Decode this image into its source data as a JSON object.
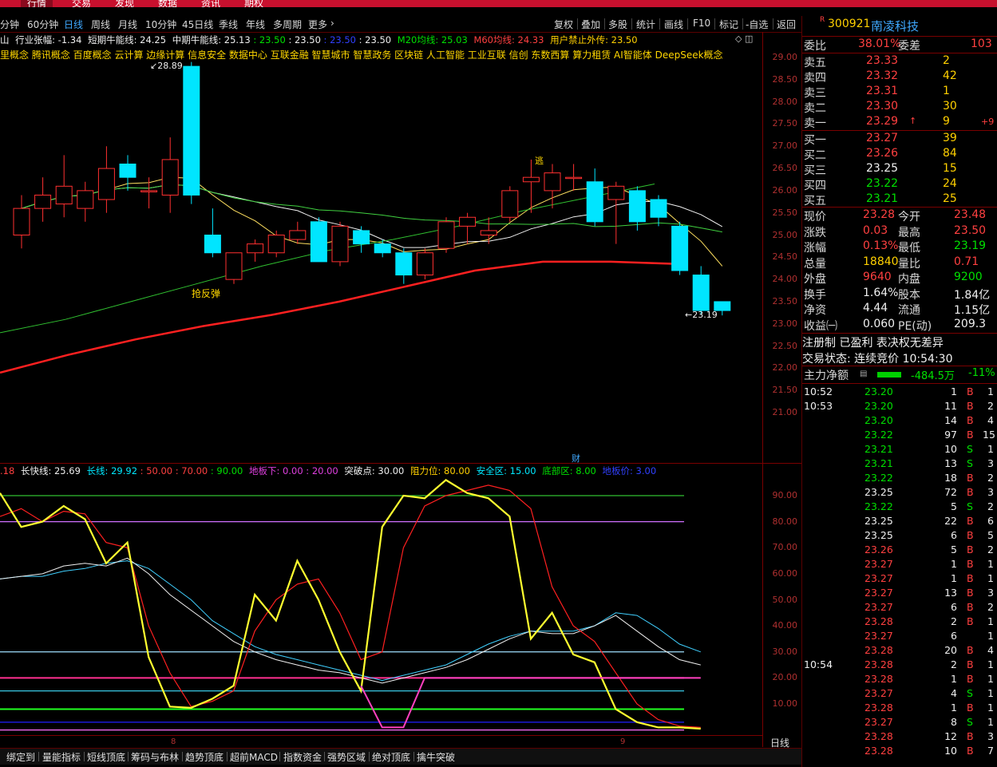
{
  "top_nav": {
    "items": [
      "行情",
      "交易",
      "发现",
      "数据",
      "资讯",
      "期权"
    ]
  },
  "period_bar": {
    "periods": [
      "分钟",
      "60分钟",
      "日线",
      "周线",
      "月线",
      "10分钟",
      "45日线",
      "季线",
      "年线",
      "多周期",
      "更多"
    ],
    "active": "日线",
    "tools": [
      "复权",
      "叠加",
      "多股",
      "统计",
      "画线",
      "F10",
      "标记",
      "-自选",
      "返回"
    ]
  },
  "main_header": {
    "seg1": "山",
    "seg2": "行业张幅: -1.34",
    "seg3": "短期牛能线: 24.25",
    "seg4": "中期牛能线: 25.13",
    "seg5": ": 23.50",
    "seg6": ": 23.50",
    "seg7": ": 23.50",
    "seg8": ": 23.50",
    "seg9": "M20均线: 25.03",
    "seg10": "M60均线: 24.33",
    "seg11": "用户禁止外传: 23.50"
  },
  "concepts": "里概念 腾讯概念 百度概念 云计算 边缘计算 信息安全 数据中心 互联金融 智慧城市 智慧政务 区块链 人工智能 工业互联 信创 东数西算 算力租赁 AI智能体 DeepSeek概念",
  "main_axis": [
    "29.00",
    "28.50",
    "28.00",
    "27.50",
    "27.00",
    "26.50",
    "26.00",
    "25.50",
    "25.00",
    "24.50",
    "24.00",
    "23.50",
    "23.00",
    "22.50",
    "22.00",
    "21.50",
    "21.00"
  ],
  "annotations": {
    "high": "28.89",
    "low": "23.19",
    "rebound": "抢反弹",
    "escape": "逃",
    "finance": "财"
  },
  "sub_header": {
    "seg1": ".18",
    "seg2": "长快线: 25.69",
    "seg3": "长线: 29.92",
    "seg4": ": 50.00",
    "seg5": ": 70.00",
    "seg6": ": 90.00",
    "seg7": "地板下: 0.00",
    "seg8": ": 20.00",
    "seg9": "突破点: 30.00",
    "seg10": "阻力位: 80.00",
    "seg11": "安全区: 15.00",
    "seg12": "底部区: 8.00",
    "seg13": "地板价: 3.00"
  },
  "sub_axis": [
    "90.00",
    "80.00",
    "70.00",
    "60.00",
    "50.00",
    "40.00",
    "30.00",
    "20.00",
    "10.00"
  ],
  "month_marks": [
    "8",
    "9"
  ],
  "bottom_right": {
    "period": "日线",
    "plus": "+",
    "minus": "-"
  },
  "bottom_tabs": [
    "绑定到",
    "量能指标",
    "短线顶底",
    "筹码与布林",
    "趋势顶底",
    "超前MACD",
    "指数资金",
    "强势区域",
    "绝对顶底",
    "擒牛突破"
  ],
  "stock": {
    "badge": "R",
    "code": "300921",
    "name": "南凌科技"
  },
  "committee": {
    "ratio_label": "委比",
    "ratio": "38.01%",
    "diff_label": "委差",
    "diff": "103"
  },
  "asks": [
    {
      "label": "卖五",
      "price": "23.33",
      "vol": "2",
      "extra": ""
    },
    {
      "label": "卖四",
      "price": "23.32",
      "vol": "42",
      "extra": ""
    },
    {
      "label": "卖三",
      "price": "23.31",
      "vol": "1",
      "extra": ""
    },
    {
      "label": "卖二",
      "price": "23.30",
      "vol": "30",
      "extra": ""
    },
    {
      "label": "卖一",
      "price": "23.29",
      "vol": "9",
      "extra": "+9"
    }
  ],
  "bids": [
    {
      "label": "买一",
      "price": "23.27",
      "vol": "39"
    },
    {
      "label": "买二",
      "price": "23.26",
      "vol": "84"
    },
    {
      "label": "买三",
      "price": "23.25",
      "vol": "15"
    },
    {
      "label": "买四",
      "price": "23.22",
      "vol": "24"
    },
    {
      "label": "买五",
      "price": "23.21",
      "vol": "25"
    }
  ],
  "quote": [
    {
      "l1": "现价",
      "v1": "23.28",
      "c1": "red",
      "l2": "今开",
      "v2": "23.48",
      "c2": "red"
    },
    {
      "l1": "涨跌",
      "v1": "0.03",
      "c1": "red",
      "l2": "最高",
      "v2": "23.50",
      "c2": "red"
    },
    {
      "l1": "涨幅",
      "v1": "0.13%",
      "c1": "red",
      "l2": "最低",
      "v2": "23.19",
      "c2": "green"
    },
    {
      "l1": "总量",
      "v1": "18840",
      "c1": "yellow",
      "l2": "量比",
      "v2": "0.71",
      "c2": "red"
    },
    {
      "l1": "外盘",
      "v1": "9640",
      "c1": "red",
      "l2": "内盘",
      "v2": "9200",
      "c2": "green"
    },
    {
      "l1": "换手",
      "v1": "1.64%",
      "c1": "white",
      "l2": "股本",
      "v2": "1.84亿",
      "c2": "white"
    },
    {
      "l1": "净资",
      "v1": "4.44",
      "c1": "white",
      "l2": "流通",
      "v2": "1.15亿",
      "c2": "white"
    },
    {
      "l1": "收益㈠",
      "v1": "0.060",
      "c1": "white",
      "l2": "PE(动)",
      "v2": "209.3",
      "c2": "white"
    }
  ],
  "registration": "注册制 已盈利 表决权无差异",
  "trade_status": "交易状态: 连续竞价 10:54:30",
  "main_force": {
    "label": "主力净额",
    "value": "-484.5万",
    "pct": "-11%"
  },
  "ticks": [
    {
      "time": "10:52",
      "price": "23.20",
      "pc": "green",
      "vol": "1",
      "side": "B",
      "n": "1"
    },
    {
      "time": "10:53",
      "price": "23.20",
      "pc": "green",
      "vol": "11",
      "side": "B",
      "n": "2"
    },
    {
      "time": "",
      "price": "23.20",
      "pc": "green",
      "vol": "14",
      "side": "B",
      "n": "4"
    },
    {
      "time": "",
      "price": "23.22",
      "pc": "green",
      "vol": "97",
      "side": "B",
      "n": "15"
    },
    {
      "time": "",
      "price": "23.21",
      "pc": "green",
      "vol": "10",
      "side": "S",
      "n": "1"
    },
    {
      "time": "",
      "price": "23.21",
      "pc": "green",
      "vol": "13",
      "side": "S",
      "n": "3"
    },
    {
      "time": "",
      "price": "23.22",
      "pc": "green",
      "vol": "18",
      "side": "B",
      "n": "2"
    },
    {
      "time": "",
      "price": "23.25",
      "pc": "white",
      "vol": "72",
      "side": "B",
      "n": "3"
    },
    {
      "time": "",
      "price": "23.22",
      "pc": "green",
      "vol": "5",
      "side": "S",
      "n": "2"
    },
    {
      "time": "",
      "price": "23.25",
      "pc": "white",
      "vol": "22",
      "side": "B",
      "n": "6"
    },
    {
      "time": "",
      "price": "23.25",
      "pc": "white",
      "vol": "6",
      "side": "B",
      "n": "5"
    },
    {
      "time": "",
      "price": "23.26",
      "pc": "red",
      "vol": "5",
      "side": "B",
      "n": "2"
    },
    {
      "time": "",
      "price": "23.27",
      "pc": "red",
      "vol": "1",
      "side": "B",
      "n": "1"
    },
    {
      "time": "",
      "price": "23.27",
      "pc": "red",
      "vol": "1",
      "side": "B",
      "n": "1"
    },
    {
      "time": "",
      "price": "23.27",
      "pc": "red",
      "vol": "13",
      "side": "B",
      "n": "3"
    },
    {
      "time": "",
      "price": "23.27",
      "pc": "red",
      "vol": "6",
      "side": "B",
      "n": "2"
    },
    {
      "time": "",
      "price": "23.28",
      "pc": "red",
      "vol": "2",
      "side": "B",
      "n": "1"
    },
    {
      "time": "",
      "price": "23.27",
      "pc": "red",
      "vol": "6",
      "side": "",
      "n": "1"
    },
    {
      "time": "",
      "price": "23.28",
      "pc": "red",
      "vol": "20",
      "side": "B",
      "n": "4"
    },
    {
      "time": "10:54",
      "price": "23.28",
      "pc": "red",
      "vol": "2",
      "side": "B",
      "n": "1"
    },
    {
      "time": "",
      "price": "23.28",
      "pc": "red",
      "vol": "1",
      "side": "B",
      "n": "1"
    },
    {
      "time": "",
      "price": "23.27",
      "pc": "red",
      "vol": "4",
      "side": "S",
      "n": "1"
    },
    {
      "time": "",
      "price": "23.28",
      "pc": "red",
      "vol": "1",
      "side": "B",
      "n": "1"
    },
    {
      "time": "",
      "price": "23.27",
      "pc": "red",
      "vol": "8",
      "side": "S",
      "n": "1"
    },
    {
      "time": "",
      "price": "23.28",
      "pc": "red",
      "vol": "12",
      "side": "B",
      "n": "3"
    },
    {
      "time": "",
      "price": "23.28",
      "pc": "red",
      "vol": "10",
      "side": "B",
      "n": "7"
    }
  ],
  "candles": [
    {
      "o": 25.0,
      "c": 25.6,
      "h": 25.9,
      "l": 24.7
    },
    {
      "o": 25.6,
      "c": 25.9,
      "h": 26.3,
      "l": 25.3
    },
    {
      "o": 25.7,
      "c": 26.1,
      "h": 26.8,
      "l": 25.4
    },
    {
      "o": 25.6,
      "c": 26.0,
      "h": 26.2,
      "l": 25.3
    },
    {
      "o": 25.8,
      "c": 26.5,
      "h": 27.0,
      "l": 25.5
    },
    {
      "o": 26.6,
      "c": 26.3,
      "h": 26.8,
      "l": 26.0
    },
    {
      "o": 26.0,
      "c": 26.0,
      "h": 26.3,
      "l": 25.6
    },
    {
      "o": 25.9,
      "c": 26.7,
      "h": 27.2,
      "l": 25.5
    },
    {
      "o": 28.8,
      "c": 25.9,
      "h": 28.9,
      "l": 25.7
    },
    {
      "o": 25.0,
      "c": 24.6,
      "h": 25.6,
      "l": 24.5
    },
    {
      "o": 24.0,
      "c": 24.6,
      "h": 24.6,
      "l": 23.9
    },
    {
      "o": 24.6,
      "c": 24.8,
      "h": 24.9,
      "l": 24.4
    },
    {
      "o": 24.6,
      "c": 25.0,
      "h": 25.1,
      "l": 24.5
    },
    {
      "o": 24.9,
      "c": 25.1,
      "h": 25.3,
      "l": 24.8
    },
    {
      "o": 25.3,
      "c": 24.4,
      "h": 25.4,
      "l": 24.4
    },
    {
      "o": 24.4,
      "c": 25.2,
      "h": 25.3,
      "l": 24.3
    },
    {
      "o": 25.1,
      "c": 24.8,
      "h": 25.2,
      "l": 24.6
    },
    {
      "o": 24.8,
      "c": 24.6,
      "h": 24.9,
      "l": 24.5
    },
    {
      "o": 24.6,
      "c": 24.1,
      "h": 24.7,
      "l": 23.9
    },
    {
      "o": 24.1,
      "c": 24.6,
      "h": 24.7,
      "l": 24.0
    },
    {
      "o": 24.7,
      "c": 25.3,
      "h": 25.4,
      "l": 24.6
    },
    {
      "o": 25.2,
      "c": 25.4,
      "h": 25.5,
      "l": 24.8
    },
    {
      "o": 25.0,
      "c": 25.1,
      "h": 25.4,
      "l": 24.8
    },
    {
      "o": 25.4,
      "c": 26.0,
      "h": 26.1,
      "l": 25.3
    },
    {
      "o": 26.2,
      "c": 26.3,
      "h": 26.7,
      "l": 25.5
    },
    {
      "o": 26.0,
      "c": 26.4,
      "h": 26.6,
      "l": 25.6
    },
    {
      "o": 26.3,
      "c": 26.3,
      "h": 26.6,
      "l": 26.0
    },
    {
      "o": 26.2,
      "c": 25.3,
      "h": 26.5,
      "l": 25.2
    },
    {
      "o": 25.8,
      "c": 26.1,
      "h": 26.2,
      "l": 24.8
    },
    {
      "o": 26.0,
      "c": 25.3,
      "h": 26.1,
      "l": 25.1
    },
    {
      "o": 25.8,
      "c": 25.4,
      "h": 25.9,
      "l": 25.2
    },
    {
      "o": 25.2,
      "c": 24.2,
      "h": 25.3,
      "l": 24.1
    },
    {
      "o": 24.1,
      "c": 23.3,
      "h": 24.3,
      "l": 23.2
    },
    {
      "o": 23.5,
      "c": 23.3,
      "h": 23.5,
      "l": 23.19
    }
  ]
}
